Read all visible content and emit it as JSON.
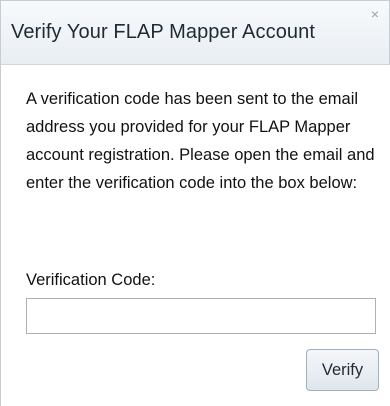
{
  "dialog": {
    "title": "Verify Your FLAP Mapper Account",
    "close_glyph": "×",
    "message": "A verification code has been sent to the email address you provided for your FLAP Mapper account registration. Please open the email and enter the verification code into the box below:",
    "code_label": "Verification Code:",
    "code_value": "",
    "code_placeholder": "",
    "verify_label": "Verify"
  },
  "icons": {
    "close": "close-icon"
  }
}
